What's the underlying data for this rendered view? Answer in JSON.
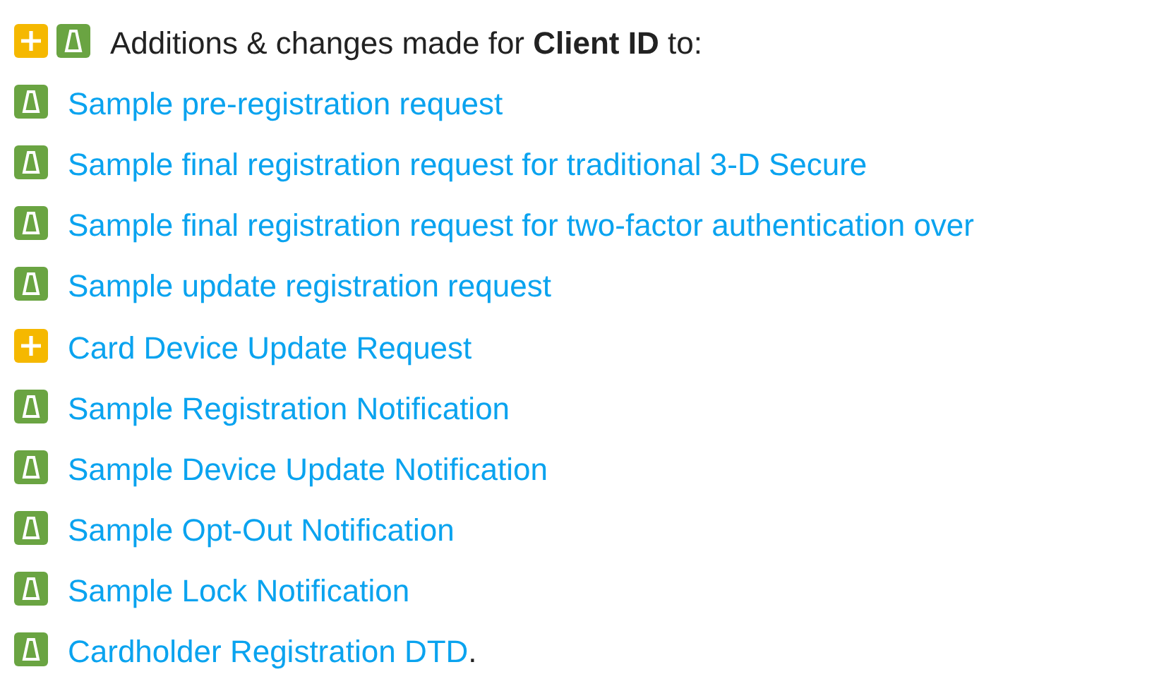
{
  "header": {
    "icons": [
      {
        "kind": "added"
      },
      {
        "kind": "changed"
      }
    ],
    "text": "Additions & changes made for **Client ID** to:"
  },
  "items": [
    {
      "kind": "changed",
      "label": "Sample pre-registration request"
    },
    {
      "kind": "changed",
      "label": "Sample final registration request for traditional 3-D Secure"
    },
    {
      "kind": "changed",
      "label": "Sample final registration request for two-factor authentication over"
    },
    {
      "kind": "changed",
      "label": "Sample update registration request"
    },
    {
      "kind": "added",
      "label": "Card Device Update Request"
    },
    {
      "kind": "changed",
      "label": "Sample Registration Notification"
    },
    {
      "kind": "changed",
      "label": "Sample Device Update Notification"
    },
    {
      "kind": "changed",
      "label": "Sample Opt-Out Notification"
    },
    {
      "kind": "changed",
      "label": "Sample Lock Notification"
    },
    {
      "kind": "changed",
      "label": "Cardholder Registration DTD",
      "suffix": "."
    }
  ]
}
